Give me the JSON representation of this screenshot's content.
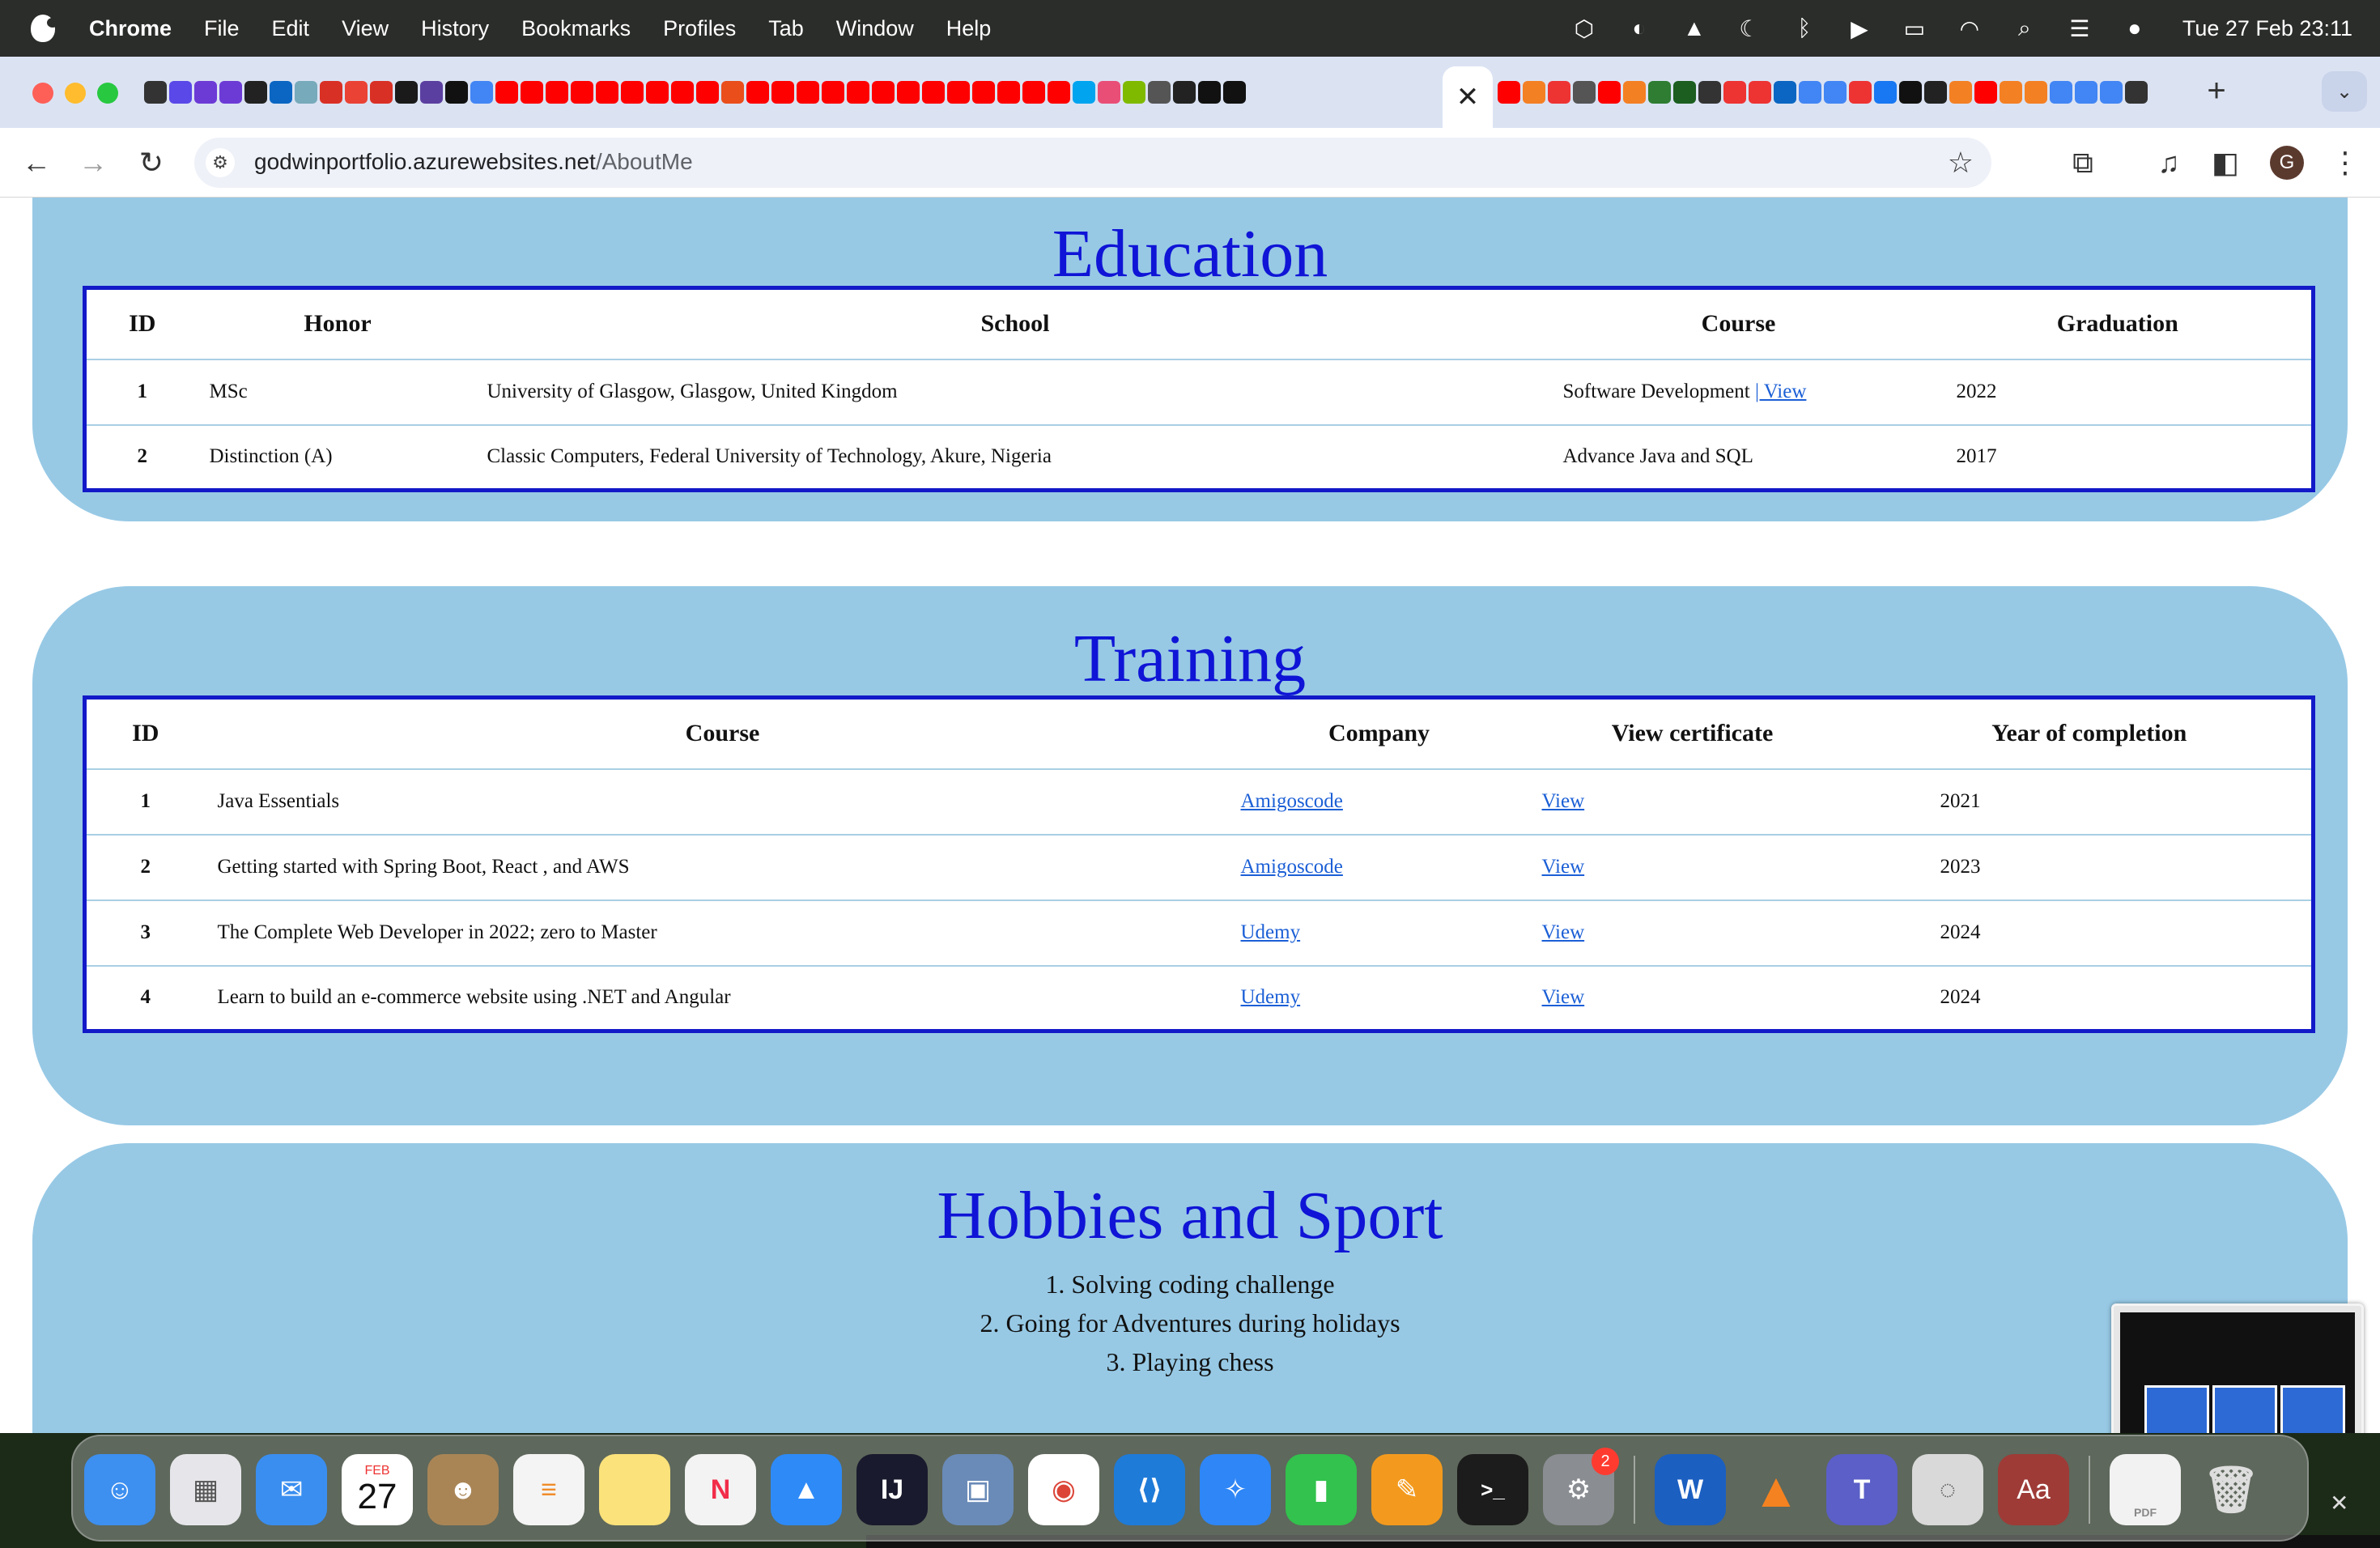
{
  "menubar": {
    "app": "Chrome",
    "items": [
      "File",
      "Edit",
      "View",
      "History",
      "Bookmarks",
      "Profiles",
      "Tab",
      "Window",
      "Help"
    ],
    "clock": "Tue 27 Feb  23:11"
  },
  "browser": {
    "active_tab_close": "✕",
    "new_tab": "+",
    "url_host": "godwinportfolio.azurewebsites.net",
    "url_path": "/AboutMe",
    "profile_initial": "G"
  },
  "education": {
    "title": "Education",
    "headers": [
      "ID",
      "Honor",
      "School",
      "Course",
      "Graduation"
    ],
    "rows": [
      {
        "id": "1",
        "honor": "MSc",
        "school": "University of Glasgow, Glasgow, United Kingdom",
        "course": "Software Development ",
        "link": "| View",
        "graduation": "2022"
      },
      {
        "id": "2",
        "honor": "Distinction (A)",
        "school": "Classic Computers, Federal University of Technology, Akure, Nigeria",
        "course": "Advance Java and SQL",
        "link": "",
        "graduation": "2017"
      }
    ]
  },
  "training": {
    "title": "Training",
    "headers": [
      "ID",
      "Course",
      "Company",
      "View certificate",
      "Year of completion"
    ],
    "rows": [
      {
        "id": "1",
        "course": "Java Essentials",
        "company": "Amigoscode",
        "certificate": "View",
        "year": "2021"
      },
      {
        "id": "2",
        "course": "Getting started with Spring Boot, React , and AWS",
        "company": "Amigoscode",
        "certificate": "View",
        "year": "2023"
      },
      {
        "id": "3",
        "course": "The Complete Web Developer in 2022; zero to Master",
        "company": "Udemy",
        "certificate": "View",
        "year": "2024"
      },
      {
        "id": "4",
        "course": "Learn to build an e-commerce website using .NET and Angular",
        "company": "Udemy",
        "certificate": "View",
        "year": "2024"
      }
    ]
  },
  "hobbies": {
    "title": "Hobbies and Sport",
    "items": [
      "1. Solving coding challenge",
      "2. Going for Adventures during holidays",
      "3. Playing chess"
    ]
  },
  "dock": {
    "calendar_month": "FEB",
    "calendar_day": "27",
    "settings_badge": "2",
    "intellij_label": "IJ",
    "word_label": "W",
    "teams_label": "T",
    "dictionary_label": "Aa",
    "terminal_label": ">_",
    "pdf_label": "PDF",
    "close": "✕"
  }
}
